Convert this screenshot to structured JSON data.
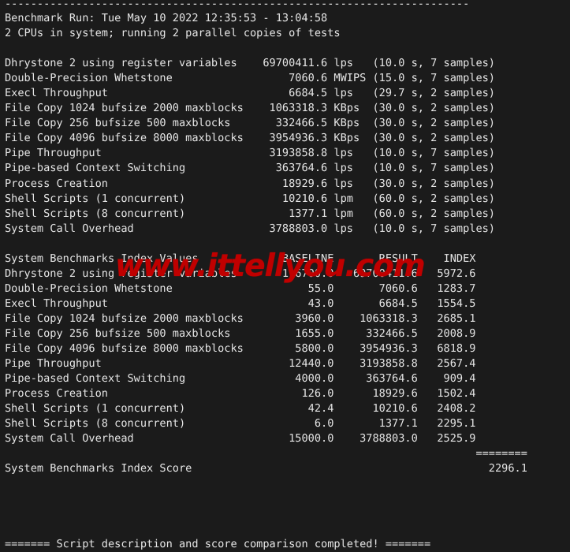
{
  "terminal": {
    "background_color": "#1b1b1b",
    "foreground_color": "#e6e6e6",
    "top_rule": "------------------------------------------------------------------------",
    "header": {
      "run_line": "Benchmark Run: Tue May 10 2022 12:35:53 - 13:04:58",
      "cpu_line": "2 CPUs in system; running 2 parallel copies of tests"
    },
    "results_block": [
      {
        "name": "Dhrystone 2 using register variables",
        "value": "69700411.6",
        "unit": "lps",
        "samples": "(10.0 s, 7 samples)"
      },
      {
        "name": "Double-Precision Whetstone",
        "value": "7060.6",
        "unit": "MWIPS",
        "samples": "(15.0 s, 7 samples)"
      },
      {
        "name": "Execl Throughput",
        "value": "6684.5",
        "unit": "lps",
        "samples": "(29.7 s, 2 samples)"
      },
      {
        "name": "File Copy 1024 bufsize 2000 maxblocks",
        "value": "1063318.3",
        "unit": "KBps",
        "samples": "(30.0 s, 2 samples)"
      },
      {
        "name": "File Copy 256 bufsize 500 maxblocks",
        "value": "332466.5",
        "unit": "KBps",
        "samples": "(30.0 s, 2 samples)"
      },
      {
        "name": "File Copy 4096 bufsize 8000 maxblocks",
        "value": "3954936.3",
        "unit": "KBps",
        "samples": "(30.0 s, 2 samples)"
      },
      {
        "name": "Pipe Throughput",
        "value": "3193858.8",
        "unit": "lps",
        "samples": "(10.0 s, 7 samples)"
      },
      {
        "name": "Pipe-based Context Switching",
        "value": "363764.6",
        "unit": "lps",
        "samples": "(10.0 s, 7 samples)"
      },
      {
        "name": "Process Creation",
        "value": "18929.6",
        "unit": "lps",
        "samples": "(30.0 s, 2 samples)"
      },
      {
        "name": "Shell Scripts (1 concurrent)",
        "value": "10210.6",
        "unit": "lpm",
        "samples": "(60.0 s, 2 samples)"
      },
      {
        "name": "Shell Scripts (8 concurrent)",
        "value": "1377.1",
        "unit": "lpm",
        "samples": "(60.0 s, 2 samples)"
      },
      {
        "name": "System Call Overhead",
        "value": "3788803.0",
        "unit": "lps",
        "samples": "(10.0 s, 7 samples)"
      }
    ],
    "index_block": {
      "title": "System Benchmarks Index Values",
      "columns": [
        "BASELINE",
        "RESULT",
        "INDEX"
      ],
      "rows": [
        {
          "name": "Dhrystone 2 using register variables",
          "baseline": "116700.0",
          "result": "69700411.6",
          "index": "5972.6"
        },
        {
          "name": "Double-Precision Whetstone",
          "baseline": "55.0",
          "result": "7060.6",
          "index": "1283.7"
        },
        {
          "name": "Execl Throughput",
          "baseline": "43.0",
          "result": "6684.5",
          "index": "1554.5"
        },
        {
          "name": "File Copy 1024 bufsize 2000 maxblocks",
          "baseline": "3960.0",
          "result": "1063318.3",
          "index": "2685.1"
        },
        {
          "name": "File Copy 256 bufsize 500 maxblocks",
          "baseline": "1655.0",
          "result": "332466.5",
          "index": "2008.9"
        },
        {
          "name": "File Copy 4096 bufsize 8000 maxblocks",
          "baseline": "5800.0",
          "result": "3954936.3",
          "index": "6818.9"
        },
        {
          "name": "Pipe Throughput",
          "baseline": "12440.0",
          "result": "3193858.8",
          "index": "2567.4"
        },
        {
          "name": "Pipe-based Context Switching",
          "baseline": "4000.0",
          "result": "363764.6",
          "index": "909.4"
        },
        {
          "name": "Process Creation",
          "baseline": "126.0",
          "result": "18929.6",
          "index": "1502.4"
        },
        {
          "name": "Shell Scripts (1 concurrent)",
          "baseline": "42.4",
          "result": "10210.6",
          "index": "2408.2"
        },
        {
          "name": "Shell Scripts (8 concurrent)",
          "baseline": "6.0",
          "result": "1377.1",
          "index": "2295.1"
        },
        {
          "name": "System Call Overhead",
          "baseline": "15000.0",
          "result": "3788803.0",
          "index": "2525.9"
        }
      ],
      "score_rule": "========",
      "score_label": "System Benchmarks Index Score",
      "score_value": "2296.1"
    },
    "footer": "======= Script description and score comparison completed! =======",
    "watermark": {
      "text": "www.ittellyou.com",
      "color": "#c00000"
    }
  }
}
